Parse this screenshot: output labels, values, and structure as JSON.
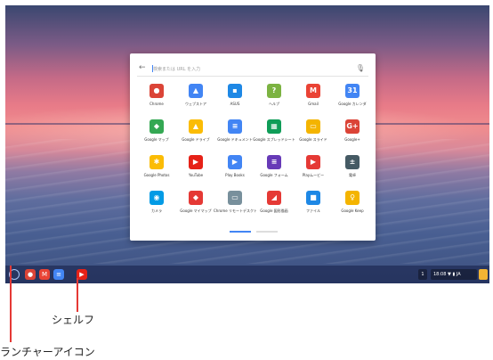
{
  "search": {
    "placeholder": "検索または URL を入力"
  },
  "apps": [
    {
      "label": "Chrome",
      "icon": "chrome-icon",
      "color": "#db4437",
      "glyph": "●"
    },
    {
      "label": "ウェブストア",
      "icon": "web-store-icon",
      "color": "#4285f4",
      "glyph": "▲"
    },
    {
      "label": "ASUS",
      "icon": "asus-icon",
      "color": "#1e88e5",
      "glyph": "▪"
    },
    {
      "label": "ヘルプ",
      "icon": "help-icon",
      "color": "#7cb342",
      "glyph": "?"
    },
    {
      "label": "Gmail",
      "icon": "gmail-icon",
      "color": "#ea4335",
      "glyph": "M"
    },
    {
      "label": "Google カレンダ",
      "icon": "calendar-icon",
      "color": "#4285f4",
      "glyph": "31"
    },
    {
      "label": "Google マップ",
      "icon": "maps-icon",
      "color": "#34a853",
      "glyph": "◆"
    },
    {
      "label": "Google ドライブ",
      "icon": "drive-icon",
      "color": "#fbbc05",
      "glyph": "▲"
    },
    {
      "label": "Google ドキュメント",
      "icon": "docs-icon",
      "color": "#4285f4",
      "glyph": "≡"
    },
    {
      "label": "Google スプレッドシート",
      "icon": "sheets-icon",
      "color": "#0f9d58",
      "glyph": "▦"
    },
    {
      "label": "Google スライド",
      "icon": "slides-icon",
      "color": "#f4b400",
      "glyph": "▭"
    },
    {
      "label": "Google+",
      "icon": "google-plus-icon",
      "color": "#db4437",
      "glyph": "G+"
    },
    {
      "label": "Google Photos",
      "icon": "photos-icon",
      "color": "#fbbc05",
      "glyph": "✱"
    },
    {
      "label": "YouTube",
      "icon": "youtube-icon",
      "color": "#e62117",
      "glyph": "▶"
    },
    {
      "label": "Play Books",
      "icon": "play-books-icon",
      "color": "#4285f4",
      "glyph": "▶"
    },
    {
      "label": "Google フォーム",
      "icon": "forms-icon",
      "color": "#673ab7",
      "glyph": "≡"
    },
    {
      "label": "Playムービー",
      "icon": "play-movies-icon",
      "color": "#e53935",
      "glyph": "▶"
    },
    {
      "label": "電卓",
      "icon": "calculator-icon",
      "color": "#455a64",
      "glyph": "±"
    },
    {
      "label": "カメラ",
      "icon": "camera-icon",
      "color": "#039be5",
      "glyph": "◉"
    },
    {
      "label": "Google マイマップ",
      "icon": "my-maps-icon",
      "color": "#e53935",
      "glyph": "◆"
    },
    {
      "label": "Chrome リモートデスクトップ",
      "icon": "remote-desktop-icon",
      "color": "#78909c",
      "glyph": "▭"
    },
    {
      "label": "Google 図形描画",
      "icon": "drawings-icon",
      "color": "#e53935",
      "glyph": "◢"
    },
    {
      "label": "ファイル",
      "icon": "files-icon",
      "color": "#1e88e5",
      "glyph": "■"
    },
    {
      "label": "Google Keep",
      "icon": "keep-icon",
      "color": "#f4b400",
      "glyph": "♀"
    }
  ],
  "shelf": {
    "items": [
      {
        "icon": "chrome-icon",
        "color": "#db4437",
        "glyph": "●"
      },
      {
        "icon": "gmail-icon",
        "color": "#ea4335",
        "glyph": "M"
      },
      {
        "icon": "docs-icon",
        "color": "#4285f4",
        "glyph": "≡"
      },
      {
        "icon": "youtube-icon",
        "color": "#e62117",
        "glyph": "▶"
      }
    ],
    "notification_count": "1",
    "time": "18:08",
    "ime": "JA"
  },
  "callouts": {
    "shelf": "シェルフ",
    "launcher": "ランチャーアイコン"
  }
}
